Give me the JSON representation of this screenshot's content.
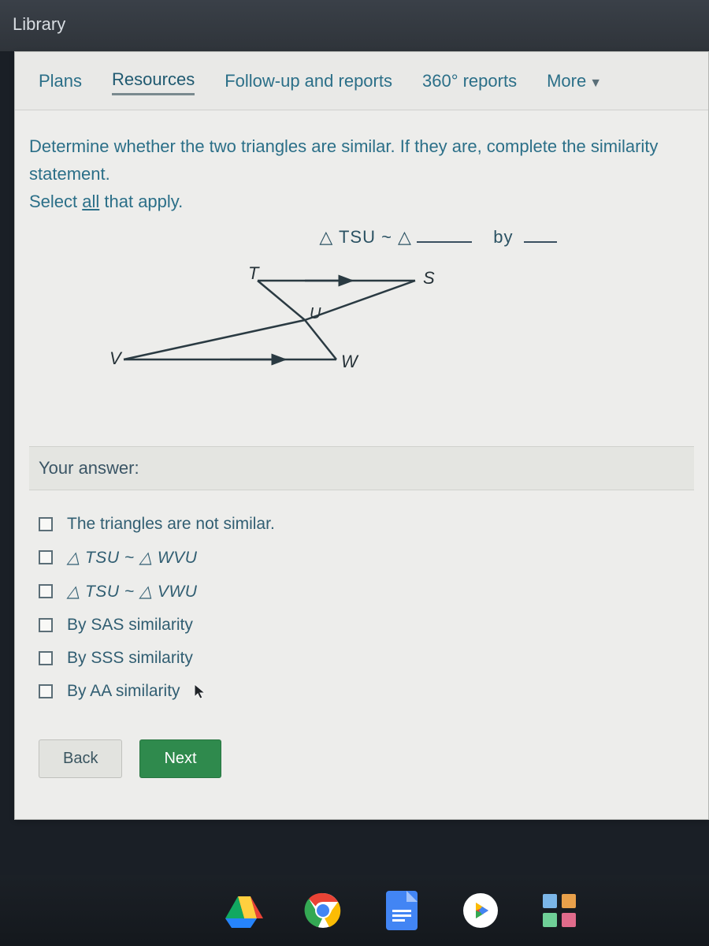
{
  "titlebar": {
    "label": "Library"
  },
  "tabs": {
    "items": [
      {
        "label": "Plans"
      },
      {
        "label": "Resources"
      },
      {
        "label": "Follow-up and reports"
      },
      {
        "label": "360° reports"
      },
      {
        "label": "More"
      }
    ]
  },
  "question": {
    "line1": "Determine whether the two triangles are similar.  If they are, complete the similarity statement.",
    "line2_pre": "Select ",
    "line2_u": "all",
    "line2_post": " that apply.",
    "eq_left": "△ TSU ~ △",
    "eq_mid": "by"
  },
  "figure": {
    "labels": {
      "T": "T",
      "S": "S",
      "U": "U",
      "V": "V",
      "W": "W"
    }
  },
  "answer": {
    "header": "Your answer:",
    "options": [
      "The triangles are not similar.",
      "△ TSU ~ △ WVU",
      "△ TSU ~ △ VWU",
      "By SAS similarity",
      "By SSS similarity",
      "By AA similarity"
    ]
  },
  "nav": {
    "back": "Back",
    "next": "Next"
  },
  "dock": {
    "items": [
      "drive-icon",
      "chrome-icon",
      "docs-icon",
      "play-icon",
      "apps-icon"
    ]
  }
}
